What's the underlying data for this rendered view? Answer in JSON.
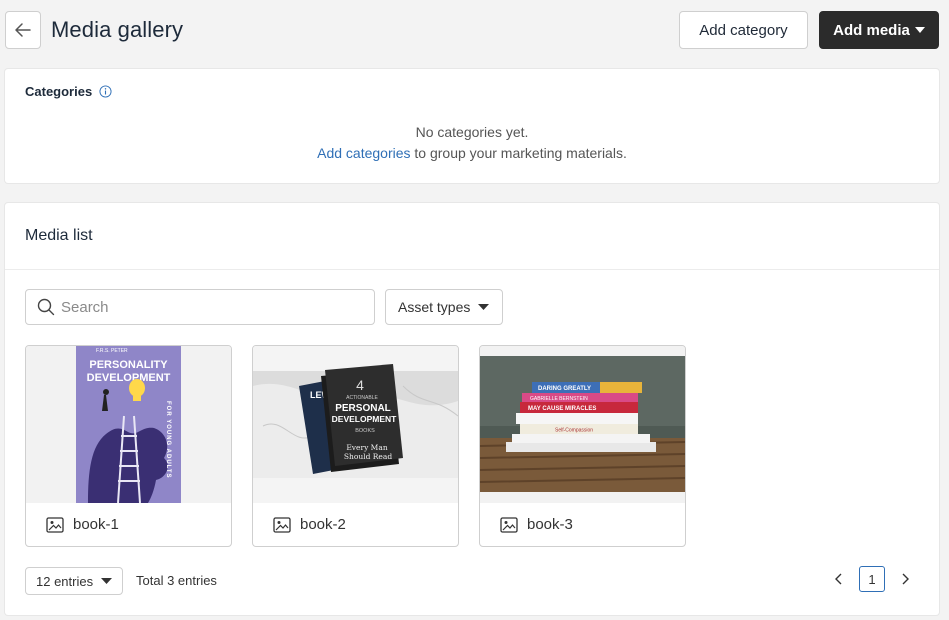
{
  "header": {
    "title": "Media gallery",
    "add_category_label": "Add category",
    "add_media_label": "Add media"
  },
  "categories": {
    "title": "Categories",
    "empty_text": "No categories yet.",
    "add_link": "Add categories",
    "add_suffix": " to group your marketing materials."
  },
  "media_list": {
    "title": "Media list",
    "search_placeholder": "Search",
    "asset_types_label": "Asset types",
    "items": [
      {
        "name": "book-1",
        "cover_author": "F.R.S. PETER",
        "cover_title_1": "PERSONALITY",
        "cover_title_2": "DEVELOPMENT",
        "cover_side_text": "FOR YOUNG ADULTS"
      },
      {
        "name": "book-2",
        "cover_number": "4",
        "cover_subtitle": "ACTIONABLE",
        "cover_title_1": "PERSONAL",
        "cover_title_2": "DEVELOPMENT",
        "cover_books": "BOOKS",
        "cover_tagline_1": "Every Man",
        "cover_tagline_2": "Should Read",
        "back_book": "LEW"
      },
      {
        "name": "book-3",
        "spine_1": "DARING GREATLY",
        "spine_2": "GABRIELLE BERNSTEIN",
        "spine_3": "MAY CAUSE MIRACLES",
        "spine_4": "Self-Compassion"
      }
    ],
    "entries_label": "12 entries",
    "total_label": "Total 3 entries",
    "current_page": "1"
  },
  "colors": {
    "primary_dark": "#2b2b2b",
    "link_blue": "#2f6fb6",
    "page_bg": "#f3f3f3"
  },
  "icons": {
    "back": "arrow-left-icon",
    "info": "info-icon",
    "search": "search-icon",
    "caret": "caret-down-icon",
    "image": "image-icon",
    "prev": "chevron-left-icon",
    "next": "chevron-right-icon"
  }
}
